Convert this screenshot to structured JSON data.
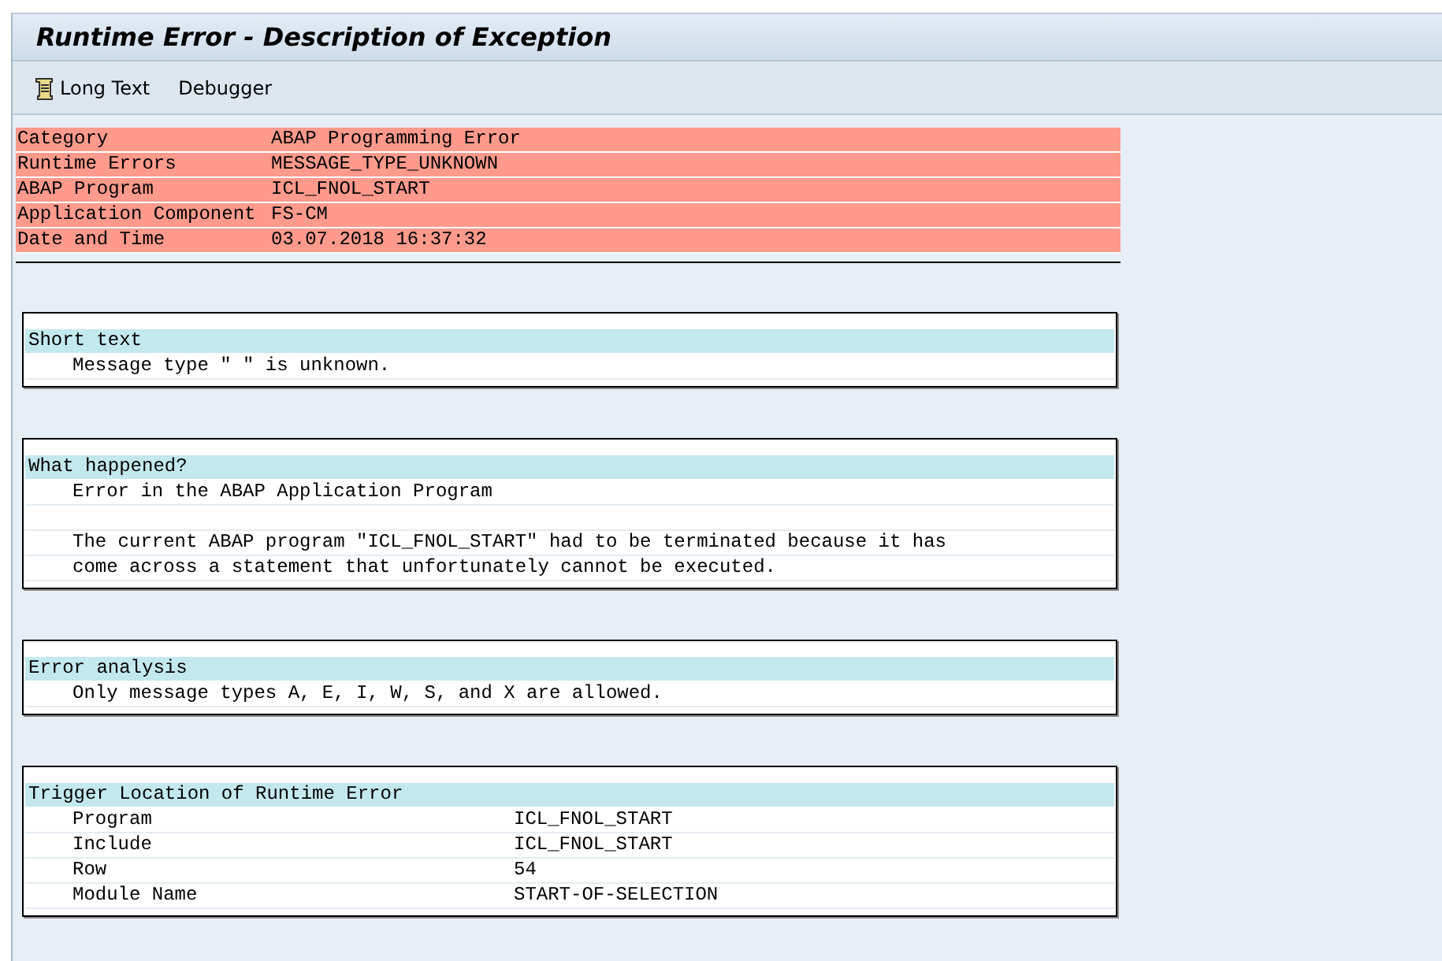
{
  "window": {
    "title": "Runtime Error - Description of Exception"
  },
  "toolbar": [
    {
      "label": "Long Text",
      "kind": "with_icon"
    },
    {
      "label": "Debugger",
      "kind": "plain"
    }
  ],
  "header_rows": [
    {
      "label": "Category",
      "value": "ABAP Programming Error"
    },
    {
      "label": "Runtime Errors",
      "value": "MESSAGE_TYPE_UNKNOWN"
    },
    {
      "label": "ABAP Program",
      "value": "ICL_FNOL_START"
    },
    {
      "label": "Application Component",
      "value": "FS-CM"
    },
    {
      "label": "Date and Time",
      "value": "03.07.2018 16:37:32"
    }
  ],
  "sections": [
    {
      "title": "Short text",
      "lines": [
        {
          "kind": "text",
          "text": "Message type \" \" is unknown."
        }
      ]
    },
    {
      "title": "What happened?",
      "lines": [
        {
          "kind": "text",
          "text": "Error in the ABAP Application Program"
        },
        {
          "kind": "blank"
        },
        {
          "kind": "text",
          "text": "The current ABAP program \"ICL_FNOL_START\" had to be terminated because it has"
        },
        {
          "kind": "text",
          "text": "come across a statement that unfortunately cannot be executed."
        }
      ]
    },
    {
      "title": "Error analysis",
      "lines": [
        {
          "kind": "text",
          "text": "Only message types A, E, I, W, S, and X are allowed."
        }
      ]
    },
    {
      "title": "Trigger Location of Runtime Error",
      "lines": [
        {
          "kind": "pair",
          "label": "Program",
          "value": "ICL_FNOL_START"
        },
        {
          "kind": "pair",
          "label": "Include",
          "value": "ICL_FNOL_START"
        },
        {
          "kind": "pair",
          "label": "Row",
          "value": "54"
        },
        {
          "kind": "pair",
          "label": "Module Name",
          "value": "START-OF-SELECTION"
        }
      ]
    }
  ]
}
